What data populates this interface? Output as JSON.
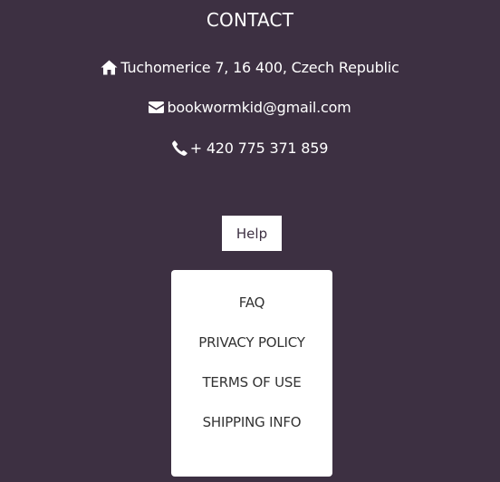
{
  "contact": {
    "title": "CONTACT",
    "address": {
      "icon": "home-icon",
      "text": "Tuchomerice 7, 16 400, Czech Republic"
    },
    "email": {
      "icon": "envelope-icon",
      "text": "bookwormkid@gmail.com"
    },
    "phone": {
      "icon": "phone-icon",
      "text": "+ 420 775 371 859"
    }
  },
  "help": {
    "button_label": "Help",
    "menu": [
      {
        "label": "FAQ"
      },
      {
        "label": "PRIVACY POLICY"
      },
      {
        "label": "TERMS OF USE"
      },
      {
        "label": "SHIPPING INFO"
      }
    ]
  },
  "colors": {
    "background": "#3d3042",
    "text": "#ffffff",
    "menu_background": "#ffffff",
    "menu_text": "#333333"
  }
}
